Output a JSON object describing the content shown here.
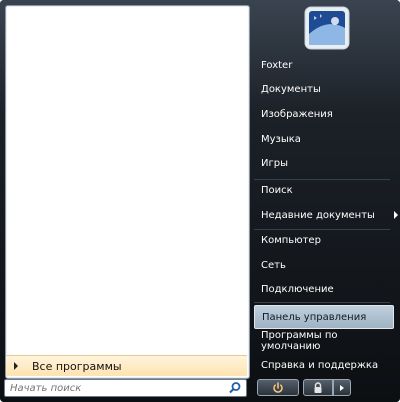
{
  "user": {
    "name": "Foxter",
    "picture_icon": "user-picture-icon"
  },
  "right_column": {
    "items": [
      {
        "label": "Foxter"
      },
      {
        "label": "Документы"
      },
      {
        "label": "Изображения"
      },
      {
        "label": "Музыка"
      },
      {
        "label": "Игры"
      },
      {
        "label": "Поиск"
      },
      {
        "label": "Недавние документы",
        "has_submenu": true
      },
      {
        "label": "Компьютер"
      },
      {
        "label": "Сеть"
      },
      {
        "label": "Подключение"
      },
      {
        "label": "Панель управления",
        "highlighted": true
      },
      {
        "label": "Программы по умолчанию"
      },
      {
        "label": "Справка и поддержка"
      }
    ]
  },
  "left_column": {
    "all_programs_label": "Все программы"
  },
  "search": {
    "placeholder": "Начать поиск",
    "icon": "search-icon"
  },
  "buttons": {
    "power_icon": "power-icon",
    "lock_icon": "lock-icon",
    "more_icon": "chevron-right-icon"
  },
  "colors": {
    "highlight": "#b3c5d4",
    "all_programs_bg": "#ffe9c0",
    "menu_bg": "#111418"
  }
}
